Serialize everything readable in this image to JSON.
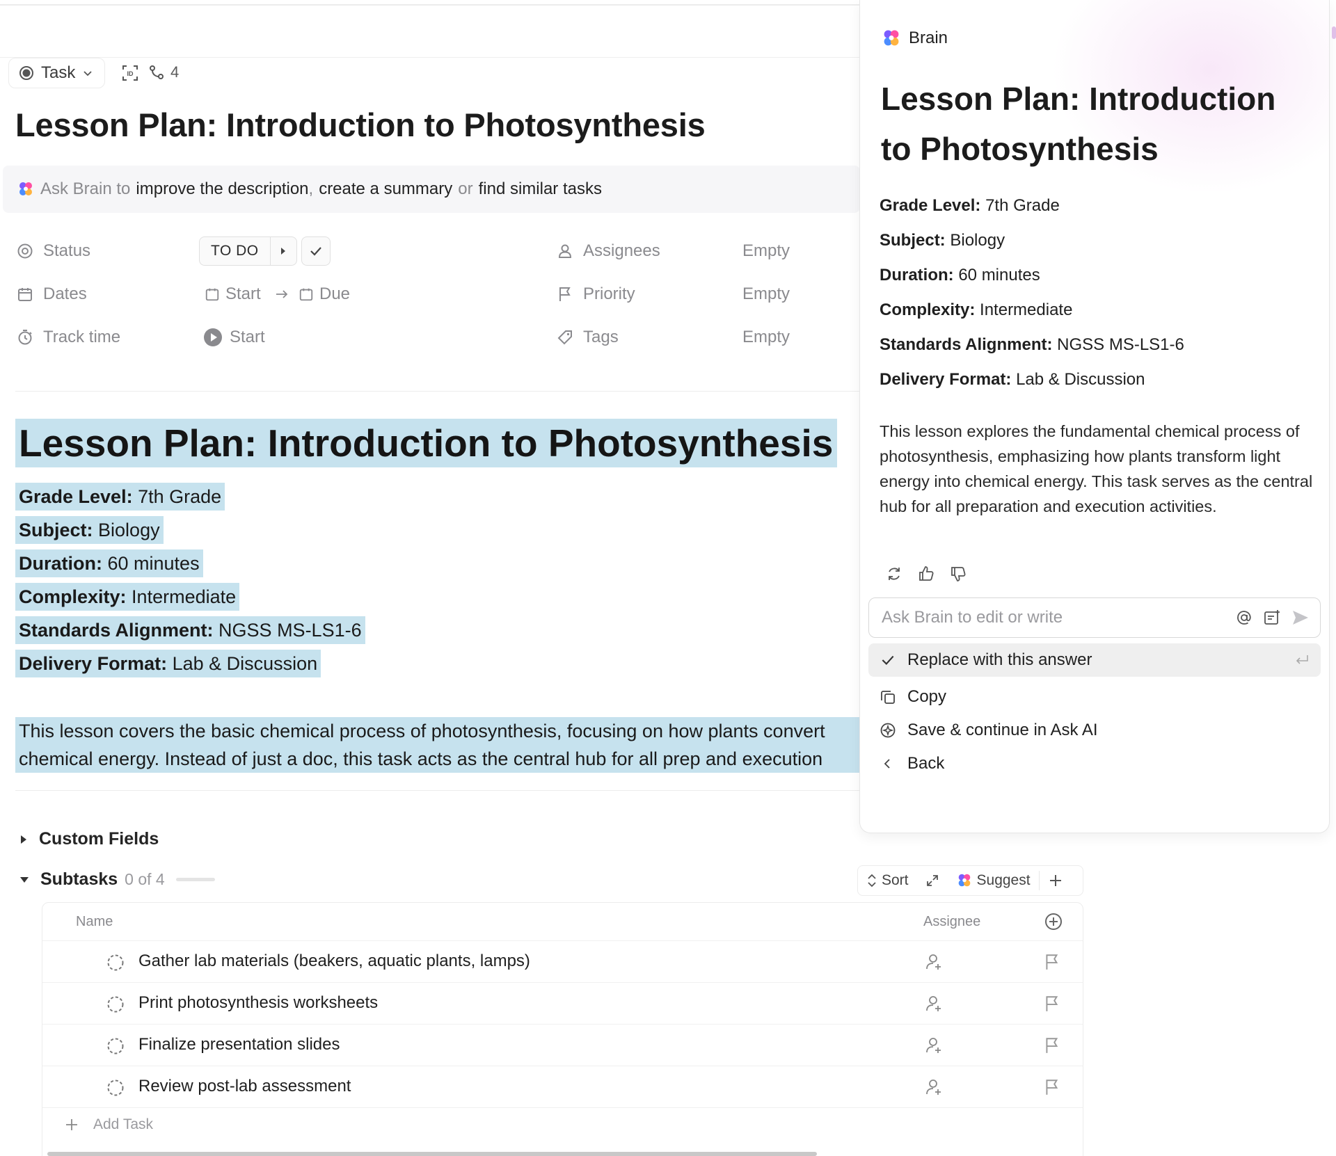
{
  "task": {
    "type_label": "Task",
    "link_count": "4",
    "title": "Lesson Plan: Introduction to Photosynthesis"
  },
  "ask_bar": {
    "prefix": "Ask Brain to",
    "action1": "improve the description",
    "sep1": ",",
    "action2": "create a summary",
    "sep2": "or",
    "action3": "find similar tasks"
  },
  "fields": {
    "status_label": "Status",
    "status_value": "TO DO",
    "dates_label": "Dates",
    "start_label": "Start",
    "due_label": "Due",
    "track_label": "Track time",
    "track_start": "Start",
    "assignees_label": "Assignees",
    "assignees_value": "Empty",
    "priority_label": "Priority",
    "priority_value": "Empty",
    "tags_label": "Tags",
    "tags_value": "Empty"
  },
  "doc": {
    "heading": "Lesson Plan: Introduction to Photosynthesis",
    "lines": [
      {
        "key": "Grade Level:",
        "value": "7th Grade"
      },
      {
        "key": "Subject:",
        "value": "Biology"
      },
      {
        "key": "Duration:",
        "value": "60 minutes"
      },
      {
        "key": "Complexity:",
        "value": "Intermediate"
      },
      {
        "key": "Standards Alignment:",
        "value": "NGSS MS-LS1-6"
      },
      {
        "key": "Delivery Format:",
        "value": "Lab & Discussion"
      }
    ],
    "para_line1": "This lesson covers the basic chemical process of photosynthesis, focusing on how plants convert",
    "para_line2": "chemical energy. Instead of just a doc, this task acts as the central hub for all prep and execution"
  },
  "sections": {
    "custom_fields": "Custom Fields",
    "subtasks": "Subtasks",
    "subtasks_count": "0 of 4",
    "subtasks_progress": 0
  },
  "toolbar": {
    "sort": "Sort",
    "suggest": "Suggest"
  },
  "table": {
    "col_name": "Name",
    "col_assignee": "Assignee",
    "rows": [
      "Gather lab materials (beakers, aquatic plants, lamps)",
      "Print photosynthesis worksheets",
      "Finalize presentation slides",
      "Review post-lab assessment"
    ],
    "add_task": "Add Task"
  },
  "brain": {
    "header": "Brain",
    "title": "Lesson Plan: Introduction to Photosynthesis",
    "lines": [
      {
        "key": "Grade Level:",
        "value": "7th Grade"
      },
      {
        "key": "Subject:",
        "value": "Biology"
      },
      {
        "key": "Duration:",
        "value": "60 minutes"
      },
      {
        "key": "Complexity:",
        "value": "Intermediate"
      },
      {
        "key": "Standards Alignment:",
        "value": "NGSS MS-LS1-6"
      },
      {
        "key": "Delivery Format:",
        "value": "Lab & Discussion"
      }
    ],
    "paragraph": "This lesson explores the fundamental chemical process of photosynthesis, emphasizing how plants transform light energy into chemical energy. This task serves as the central hub for all preparation and execution activities.",
    "input_placeholder": "Ask Brain to edit or write",
    "menu": {
      "replace": "Replace with this answer",
      "copy": "Copy",
      "save": "Save & continue in Ask AI",
      "back": "Back"
    }
  },
  "colors": {
    "highlight": "#c6e2ee",
    "panel_glow": "#f6e0f6",
    "text_muted": "#8a8a8e"
  }
}
